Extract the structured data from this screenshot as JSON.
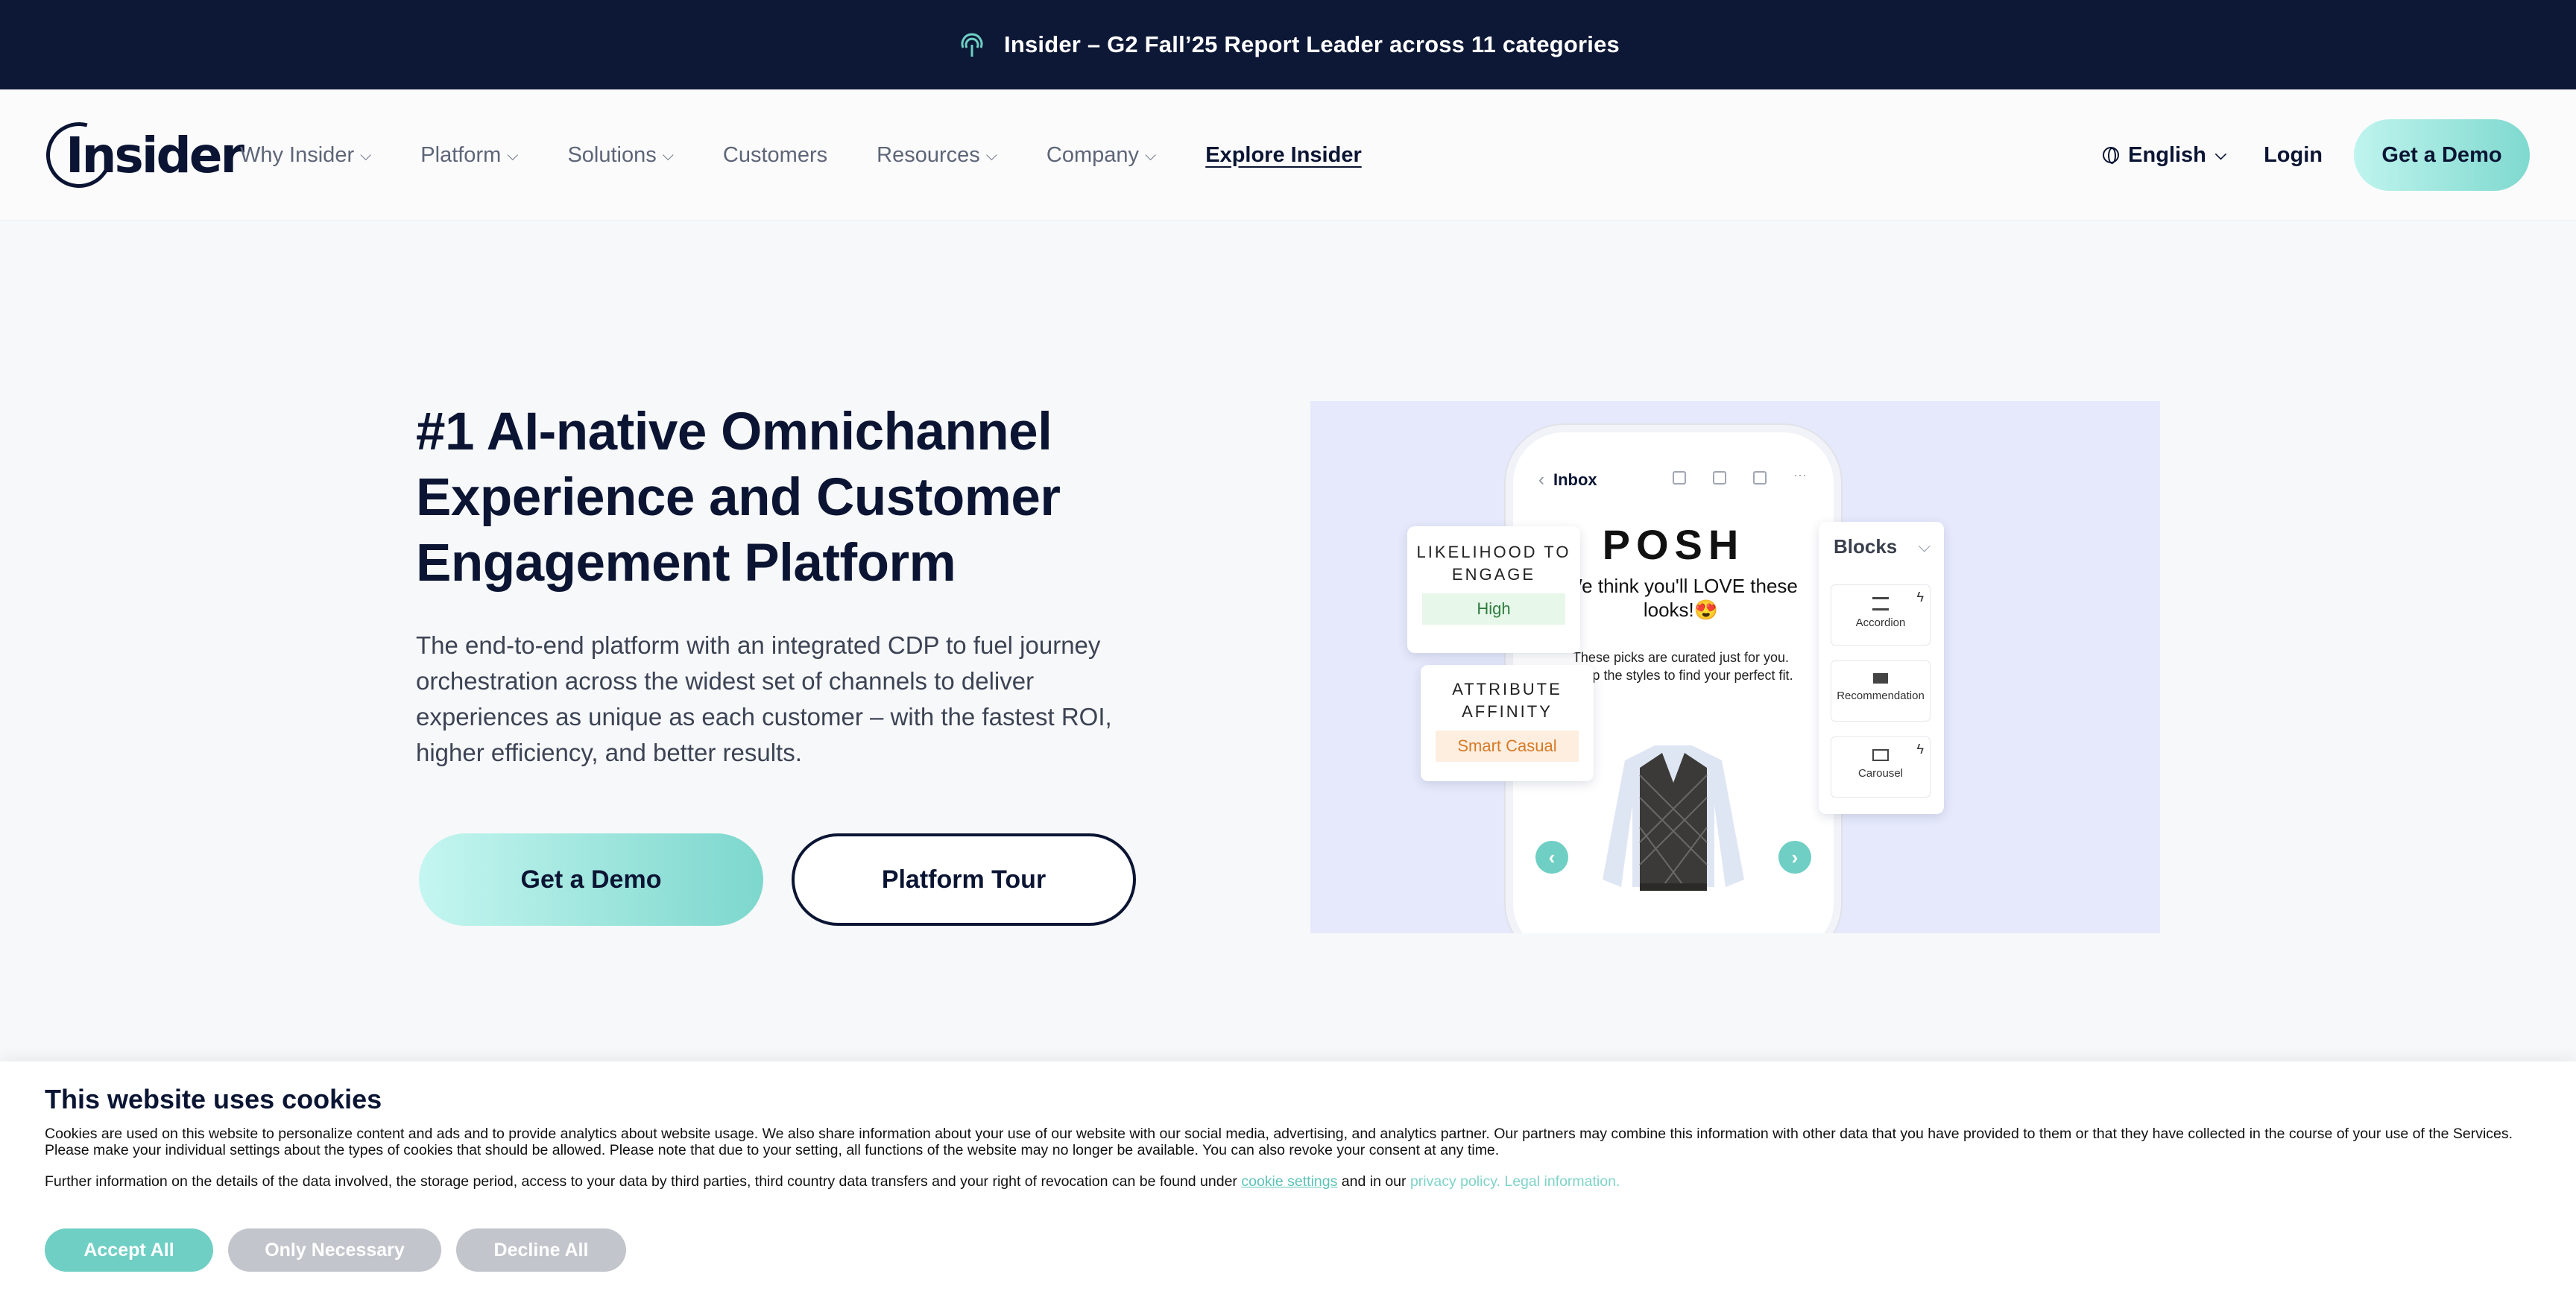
{
  "announcement": {
    "text": "Insider – G2 Fall’25 Report Leader across 11 categories",
    "icon": "signal-icon"
  },
  "nav": {
    "logo": "Insider",
    "items": [
      {
        "label": "Why Insider",
        "dropdown": true
      },
      {
        "label": "Platform",
        "dropdown": true
      },
      {
        "label": "Solutions",
        "dropdown": true
      },
      {
        "label": "Customers",
        "dropdown": false
      },
      {
        "label": "Resources",
        "dropdown": true
      },
      {
        "label": "Company",
        "dropdown": true
      },
      {
        "label": "Explore Insider",
        "dropdown": false
      }
    ],
    "language": "English",
    "login": "Login",
    "cta": "Get a Demo"
  },
  "hero": {
    "title": "#1 AI-native Omnichannel Experience and Customer Engagement Platform",
    "subtitle": "The end-to-end platform with an integrated CDP to fuel journey orchestration across the widest set of channels to deliver experiences as unique as each customer – with the fastest ROI, higher efficiency, and better results.",
    "primary_button": "Get a Demo",
    "secondary_button": "Platform Tour"
  },
  "visual": {
    "inbox_label": "Inbox",
    "brand": "POSH",
    "headline": "We think you'll LOVE these looks!😍",
    "body": "These picks are curated just for you. Shop the styles to find your perfect fit.",
    "card_engage": {
      "title": "LIKELIHOOD TO ENGAGE",
      "value": "High"
    },
    "card_affinity": {
      "title": "ATTRIBUTE AFFINITY",
      "value": "Smart Casual"
    },
    "blocks": {
      "title": "Blocks",
      "items": [
        "Accordion",
        "Recommendation",
        "Carousel"
      ]
    }
  },
  "cookie": {
    "title": "This website uses cookies",
    "text": "Cookies are used on this website to personalize content and ads and to provide analytics about website usage. We also share information about your use of our website with our social media, advertising, and analytics partner. Our partners may combine this information with other data that you have provided to them or that they have collected in the course of your use of the Services. Please make your individual settings about the types of cookies that should be allowed. Please note that due to your setting, all functions of the website may no longer be available. You can also revoke your consent at any time.",
    "further_prefix": "Further information on the details of the data involved, the storage period, access to your data by third parties, third country data transfers and your right of revocation can be found under",
    "cookie_settings_link": "cookie settings",
    "and_text": "and in our",
    "privacy_link": "privacy policy. Legal information.",
    "accept": "Accept All",
    "necessary": "Only Necessary",
    "decline": "Decline All"
  },
  "colors": {
    "navy": "#0d1836",
    "accent": "#6fcfc4",
    "hero_bg": "#e6e9fb"
  }
}
